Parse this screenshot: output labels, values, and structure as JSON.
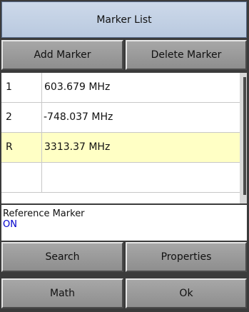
{
  "dialog": {
    "title": "Marker List"
  },
  "toolbar": {
    "add_label": "Add Marker",
    "delete_label": "Delete Marker"
  },
  "markers": [
    {
      "id": "1",
      "frequency": "603.679 MHz"
    },
    {
      "id": "2",
      "frequency": "-748.037 MHz"
    },
    {
      "id": "R",
      "frequency": "3313.37 MHz"
    }
  ],
  "reference": {
    "label": "Reference Marker",
    "value": "ON"
  },
  "actions": {
    "search": "Search",
    "properties": "Properties",
    "math": "Math",
    "ok": "Ok"
  },
  "colors": {
    "title_bg": "#c3d2e6",
    "reference_row_bg": "#ffffc5",
    "reference_value": "#0000cc"
  }
}
